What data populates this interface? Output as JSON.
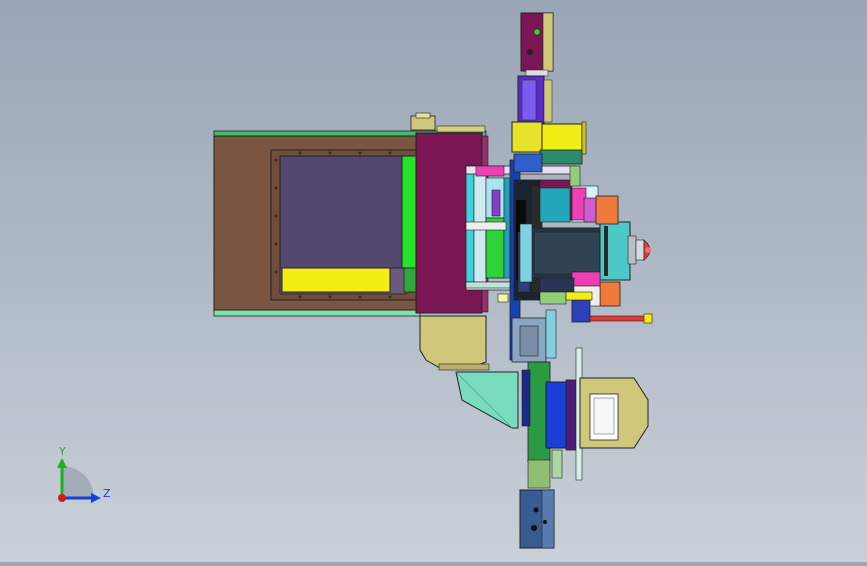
{
  "triad": {
    "y_label": "Y",
    "z_label": "Z",
    "y_color": "#19b219",
    "z_color": "#1a3fd6",
    "origin_color": "#d11a1a"
  },
  "colors": {
    "frame_brown": "#7a5540",
    "frame_purple": "#54486e",
    "cover_magenta": "#7a1654",
    "yellow": "#f2ee15",
    "green": "#27e12a",
    "teal_green": "#79dcbf",
    "cyan": "#3fd2dc",
    "khaki": "#cfc77a",
    "navy": "#3a5a92",
    "red": "#e03a3a",
    "orange": "#f07a3c",
    "pink": "#ee3fb6"
  }
}
